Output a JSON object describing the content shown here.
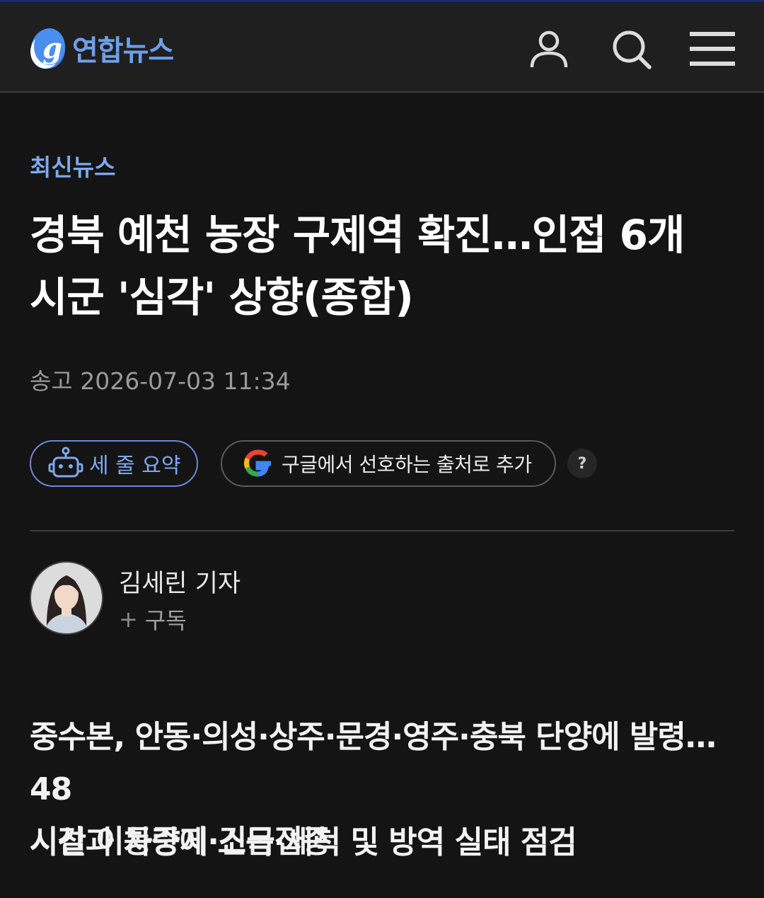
{
  "header": {
    "logo_text": "연합뉴스",
    "brand_color": "#6f9fe8",
    "icons": [
      "user-icon",
      "search-icon",
      "menu-icon"
    ]
  },
  "article": {
    "category": "최신뉴스",
    "headline_line1": "경북 예천 농장 구제역 확진…인접 6개",
    "headline_line2": "시군 '심각' 상향(종합)",
    "dateline": "송고 2026-07-03 11:34"
  },
  "actions": {
    "summary_label": "세 줄 요약",
    "google_label": "구글에서 선호하는 출처로 추가",
    "help_label": "?"
  },
  "reporter": {
    "name": "김세린 기자",
    "subscribe_plus": "+",
    "subscribe_label": "구독"
  },
  "subheads": {
    "line1a": "중수본, 안동·의성·상주·문경·영주·충북 단양에 발령…48",
    "line1b": "시간 이동중지·긴급접종",
    "line2": "시설과 차량에 소독·세척 및 방역 실태 점검"
  }
}
